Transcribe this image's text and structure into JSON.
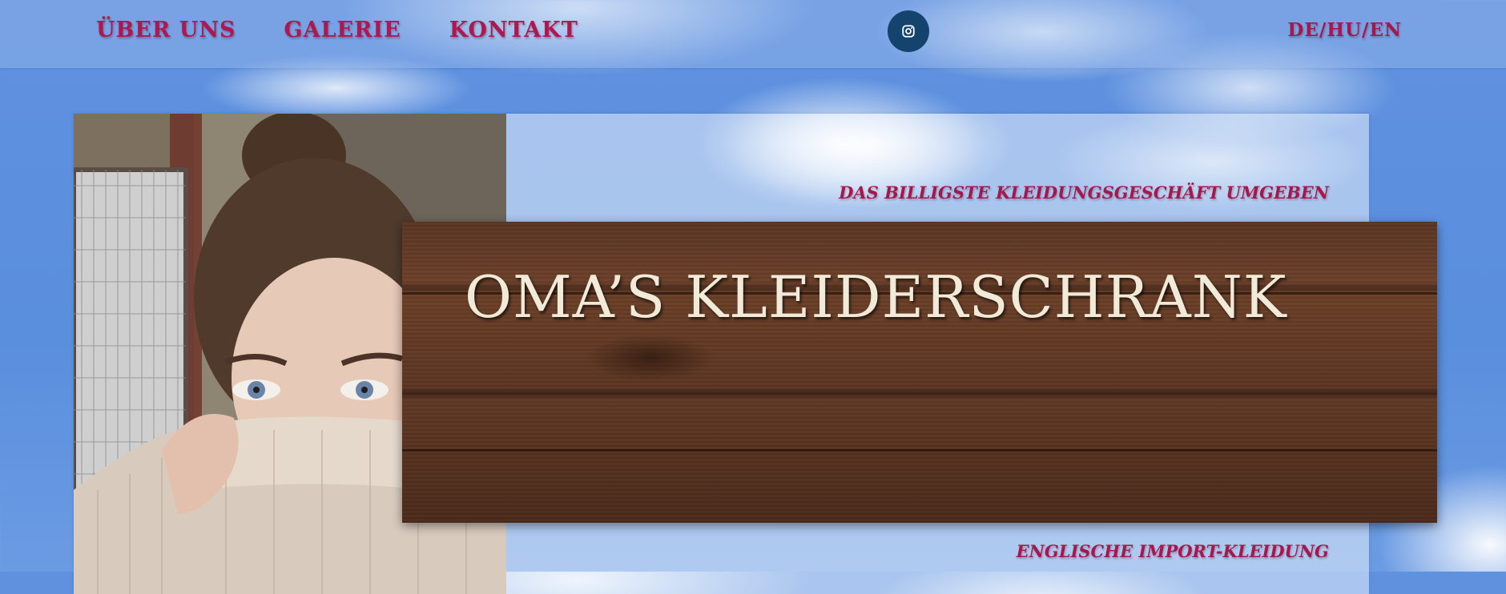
{
  "nav": {
    "items": [
      {
        "label": "ÜBER UNS"
      },
      {
        "label": "GALERIE"
      },
      {
        "label": "KONTAKT"
      }
    ]
  },
  "social": {
    "icon": "instagram-icon",
    "color": "#14436e"
  },
  "language": {
    "label": "DE/HU/EN"
  },
  "hero": {
    "tagline_top": "DAS BILLIGSTE KLEIDUNGSGESCHÄFT UMGEBEN",
    "brand_title": "OMA’S KLEIDERSCHRANK",
    "tagline_bottom": "ENGLISCHE IMPORT-KLEIDUNG"
  },
  "colors": {
    "accent": "#b0174f",
    "sky": "#5f91df",
    "wood": "#5a3523"
  }
}
